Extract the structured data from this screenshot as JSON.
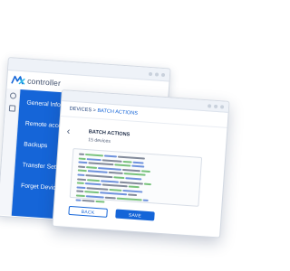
{
  "back_window": {
    "logo_text": "controller",
    "nav_items": [
      "General Info",
      "Remote access",
      "Backups",
      "Transfer Settings",
      "Forget Device"
    ]
  },
  "front_window": {
    "breadcrumb": {
      "parent": "DEVICES",
      "separator": ">",
      "current": "BATCH ACTIONS"
    },
    "page_title": "BATCH ACTIONS",
    "device_count": "15 devices",
    "back_button": "BACK",
    "save_button": "SAVE"
  },
  "colors": {
    "brand_blue": "#1565d8",
    "nav_text": "#ffffff",
    "code_green": "#4caf50",
    "code_blue": "#3f6fd1",
    "code_dark": "#5a6478"
  },
  "icons": [
    "logo-icon",
    "globe-icon",
    "gear-icon",
    "chevron-left-icon",
    "window-controls-icon"
  ]
}
